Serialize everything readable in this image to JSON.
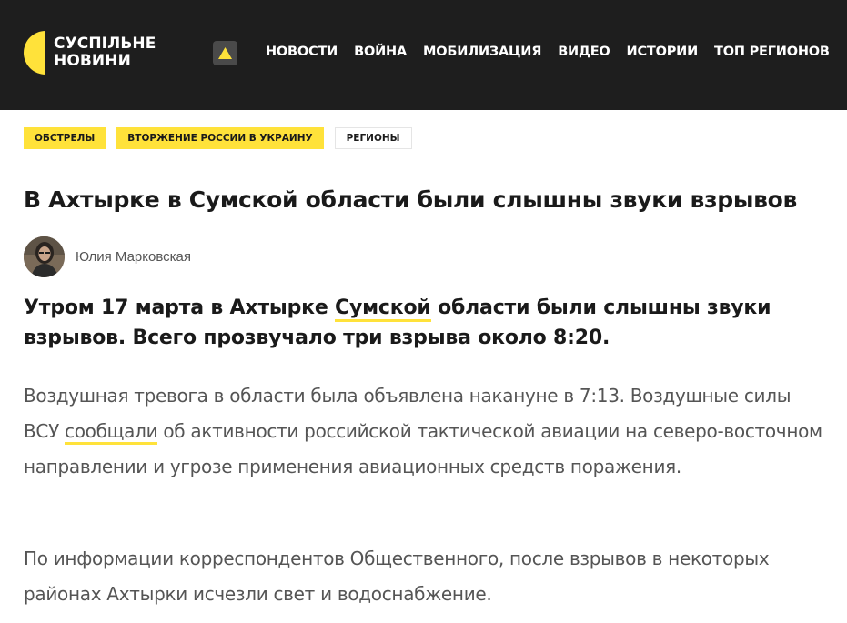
{
  "brand": {
    "line1": "СУСПІЛЬНЕ",
    "line2": "НОВИНИ",
    "accent": "#ffe23a"
  },
  "header": {
    "background": "#1e1e1e",
    "alert_icon": "warning-triangle-icon"
  },
  "nav": {
    "items": [
      "НОВОСТИ",
      "ВОЙНА",
      "МОБИЛИЗАЦИЯ",
      "ВИДЕО",
      "ИСТОРИИ",
      "ТОП РЕГИОНОВ"
    ]
  },
  "tags": [
    "ОБСТРЕЛЫ",
    "ВТОРЖЕНИЕ РОССИИ В УКРАИНУ",
    "РЕГИОНЫ"
  ],
  "article": {
    "title": "В Ахтырке в Сумской области были слышны звуки взрывов",
    "author": "Юлия Марковская",
    "lead": {
      "before": "Утром 17 марта в Ахтырке ",
      "link": "Сумской",
      "after": " области были слышны звуки взрывов. Всего прозвучало три взрыва около 8:20."
    },
    "p1": {
      "before": "Воздушная тревога в области была объявлена накануне в 7:13. Воздушные силы ВСУ ",
      "link": "сообщали",
      "after": " об активности российской тактической авиации на северо-восточном направлении и угрозе применения авиационных средств поражения."
    },
    "p2": "По информации корреспондентов Общественного, после взрывов в некоторых районах Ахтырки исчезли свет и водоснабжение."
  }
}
